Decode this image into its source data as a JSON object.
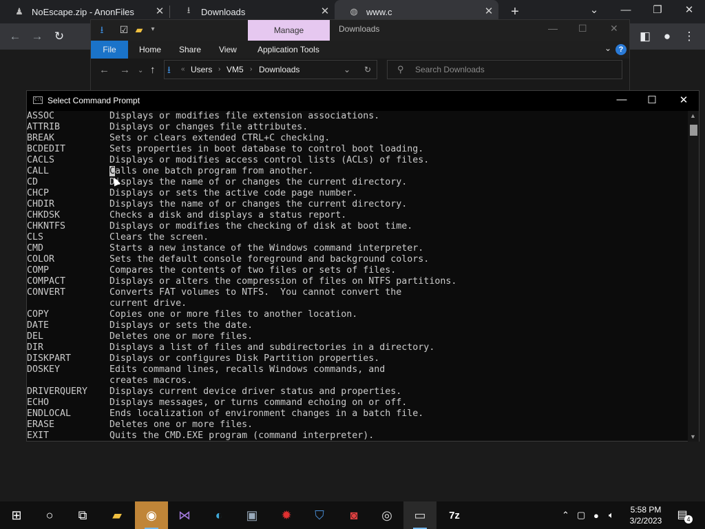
{
  "browser": {
    "tabs": [
      {
        "title": "NoEscape.zip - AnonFiles",
        "icon": "anonfiles-icon"
      },
      {
        "title": "Downloads",
        "icon": "download-icon"
      },
      {
        "title": "www.c",
        "icon": "globe-icon"
      }
    ],
    "new_tab": "+",
    "controls": {
      "minimize": "—",
      "maximize": "❐",
      "close": "✕",
      "menu": "⌄"
    }
  },
  "explorer": {
    "manage_label": "Manage",
    "title": "Downloads",
    "ribbon": [
      "File",
      "Home",
      "Share",
      "View",
      "Application Tools"
    ],
    "help": "?",
    "path": [
      "Users",
      "VM5",
      "Downloads"
    ],
    "search_placeholder": "Search Downloads"
  },
  "cmd": {
    "title": "Select Command Prompt",
    "lines": [
      {
        "cmd": "ASSOC",
        "desc": "Displays or modifies file extension associations."
      },
      {
        "cmd": "ATTRIB",
        "desc": "Displays or changes file attributes."
      },
      {
        "cmd": "BREAK",
        "desc": "Sets or clears extended CTRL+C checking."
      },
      {
        "cmd": "BCDEDIT",
        "desc": "Sets properties in boot database to control boot loading."
      },
      {
        "cmd": "CACLS",
        "desc": "Displays or modifies access control lists (ACLs) of files."
      },
      {
        "cmd": "CALL",
        "desc": "Calls one batch program from another."
      },
      {
        "cmd": "CD",
        "desc": "Displays the name of or changes the current directory."
      },
      {
        "cmd": "CHCP",
        "desc": "Displays or sets the active code page number."
      },
      {
        "cmd": "CHDIR",
        "desc": "Displays the name of or changes the current directory."
      },
      {
        "cmd": "CHKDSK",
        "desc": "Checks a disk and displays a status report."
      },
      {
        "cmd": "CHKNTFS",
        "desc": "Displays or modifies the checking of disk at boot time."
      },
      {
        "cmd": "CLS",
        "desc": "Clears the screen."
      },
      {
        "cmd": "CMD",
        "desc": "Starts a new instance of the Windows command interpreter."
      },
      {
        "cmd": "COLOR",
        "desc": "Sets the default console foreground and background colors."
      },
      {
        "cmd": "COMP",
        "desc": "Compares the contents of two files or sets of files."
      },
      {
        "cmd": "COMPACT",
        "desc": "Displays or alters the compression of files on NTFS partitions."
      },
      {
        "cmd": "CONVERT",
        "desc": "Converts FAT volumes to NTFS.  You cannot convert the"
      },
      {
        "cmd": "",
        "desc": "current drive."
      },
      {
        "cmd": "COPY",
        "desc": "Copies one or more files to another location."
      },
      {
        "cmd": "DATE",
        "desc": "Displays or sets the date."
      },
      {
        "cmd": "DEL",
        "desc": "Deletes one or more files."
      },
      {
        "cmd": "DIR",
        "desc": "Displays a list of files and subdirectories in a directory."
      },
      {
        "cmd": "DISKPART",
        "desc": "Displays or configures Disk Partition properties."
      },
      {
        "cmd": "DOSKEY",
        "desc": "Edits command lines, recalls Windows commands, and"
      },
      {
        "cmd": "",
        "desc": "creates macros."
      },
      {
        "cmd": "DRIVERQUERY",
        "desc": "Displays current device driver status and properties."
      },
      {
        "cmd": "ECHO",
        "desc": "Displays messages, or turns command echoing on or off."
      },
      {
        "cmd": "ENDLOCAL",
        "desc": "Ends localization of environment changes in a batch file."
      },
      {
        "cmd": "ERASE",
        "desc": "Deletes one or more files."
      },
      {
        "cmd": "EXIT",
        "desc": "Quits the CMD.EXE program (command interpreter)."
      }
    ]
  },
  "taskbar": {
    "time": "5:58 PM",
    "date": "3/2/2023",
    "notification_count": "4"
  }
}
